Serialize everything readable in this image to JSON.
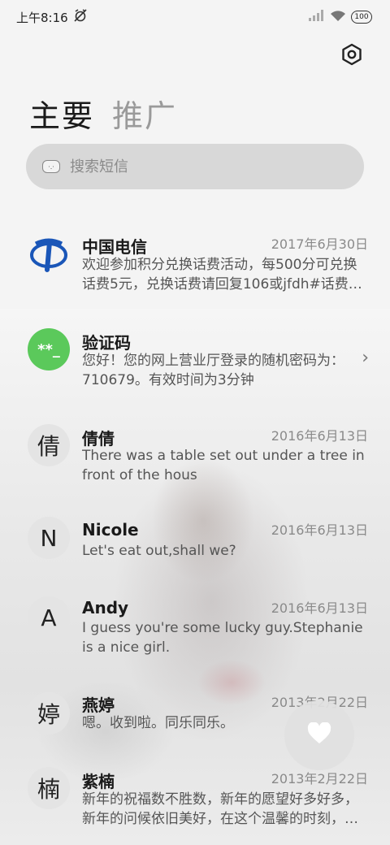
{
  "status_bar": {
    "time": "上午8:16",
    "battery": "100"
  },
  "tabs": [
    {
      "label": "主要",
      "active": true
    },
    {
      "label": "推广",
      "active": false
    }
  ],
  "search": {
    "placeholder": "搜索短信"
  },
  "messages": [
    {
      "sender": "中国电信",
      "date": "2017年6月30日",
      "preview": "欢迎参加积分兑换话费活动，每500分可兑换话费5元，兑换话费请回复106或jfdh#话费档位…",
      "avatar_icon": "china-telecom-logo"
    },
    {
      "sender": "验证码",
      "date": "",
      "preview": "您好！您的网上营业厅登录的随机密码为：710679。有效时间为3分钟",
      "avatar_text": "**_",
      "avatar_color": "#5bc95b"
    },
    {
      "sender": "倩倩",
      "date": "2016年6月13日",
      "preview": "There was a table set out under a tree in front of the hous",
      "avatar_text": "倩"
    },
    {
      "sender": "Nicole",
      "date": "2016年6月13日",
      "preview": "Let's eat out,shall we?",
      "avatar_text": "N"
    },
    {
      "sender": "Andy",
      "date": "2016年6月13日",
      "preview": "I guess you're some lucky guy.Stephanie is a nice girl.",
      "avatar_text": "A"
    },
    {
      "sender": "燕婷",
      "date": "2013年2月22日",
      "preview": "嗯。收到啦。同乐同乐。",
      "avatar_text": "婷"
    },
    {
      "sender": "紫楠",
      "date": "2013年2月22日",
      "preview": "新年的祝福数不胜数，新年的愿望好多好多，新年的问候依旧美好，在这个温馨的时刻，…",
      "avatar_text": "楠"
    }
  ],
  "icons": {
    "settings": "settings-hexagon-icon",
    "favorites": "heart-icon",
    "search": "cat-face-icon"
  }
}
